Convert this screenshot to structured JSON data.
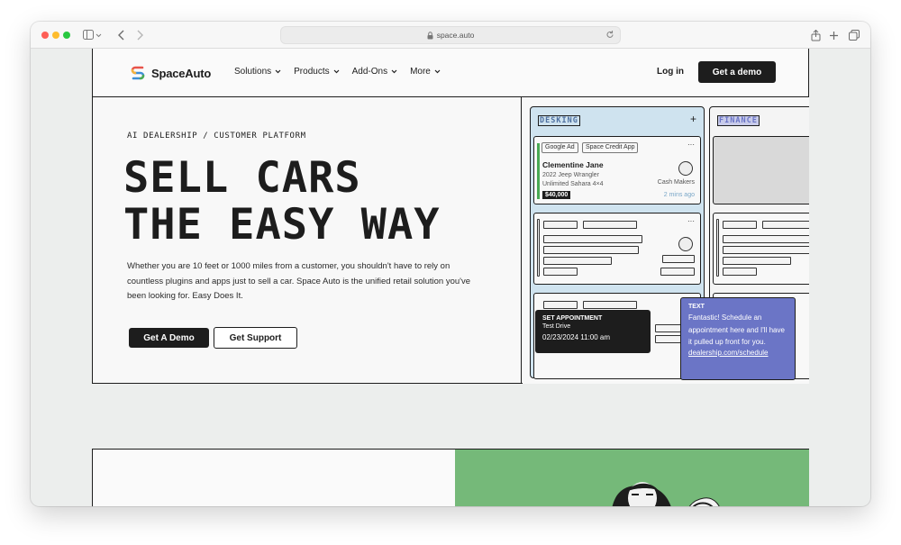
{
  "browser": {
    "url": "space.auto"
  },
  "header": {
    "logo_text": "SpaceAuto",
    "nav": [
      {
        "label": "Solutions"
      },
      {
        "label": "Products"
      },
      {
        "label": "Add-Ons"
      },
      {
        "label": "More"
      }
    ],
    "login_label": "Log in",
    "demo_label": "Get a demo"
  },
  "hero": {
    "eyebrow": "AI DEALERSHIP / CUSTOMER PLATFORM",
    "headline_line1": "SELL CARS",
    "headline_line2": "THE EASY WAY",
    "body": "Whether you are 10 feet or 1000 miles from a customer, you shouldn't have to rely on countless plugins and apps just to sell a car. Space Auto is the unified retail solution you've been looking for. Easy Does It.",
    "primary_cta": "Get A Demo",
    "secondary_cta": "Get Support"
  },
  "board": {
    "column1_label": "DESKING",
    "column2_label": "FINANCE",
    "card": {
      "tags": [
        "Google Ad",
        "Space Credit App"
      ],
      "customer": "Clementine Jane",
      "vehicle_line1": "2022 Jeep Wrangler",
      "vehicle_line2": "Unlimited Sahara 4×4",
      "price": "$40,000",
      "team": "Cash Makers",
      "time_ago": "2 mins ago"
    },
    "appointment": {
      "title": "SET APPOINTMENT",
      "type": "Test Drive",
      "datetime": "02/23/2024 11:00 am"
    },
    "text_message": {
      "title": "TEXT",
      "body": "Fantastic! Schedule an appointment here and I'll have it pulled up front for you.",
      "link": "dealership.com/schedule"
    }
  },
  "colors": {
    "dark": "#1d1d1d",
    "board_blue": "#cfe3ef",
    "message_purple": "#6b75c6",
    "section_green": "#75b979"
  }
}
